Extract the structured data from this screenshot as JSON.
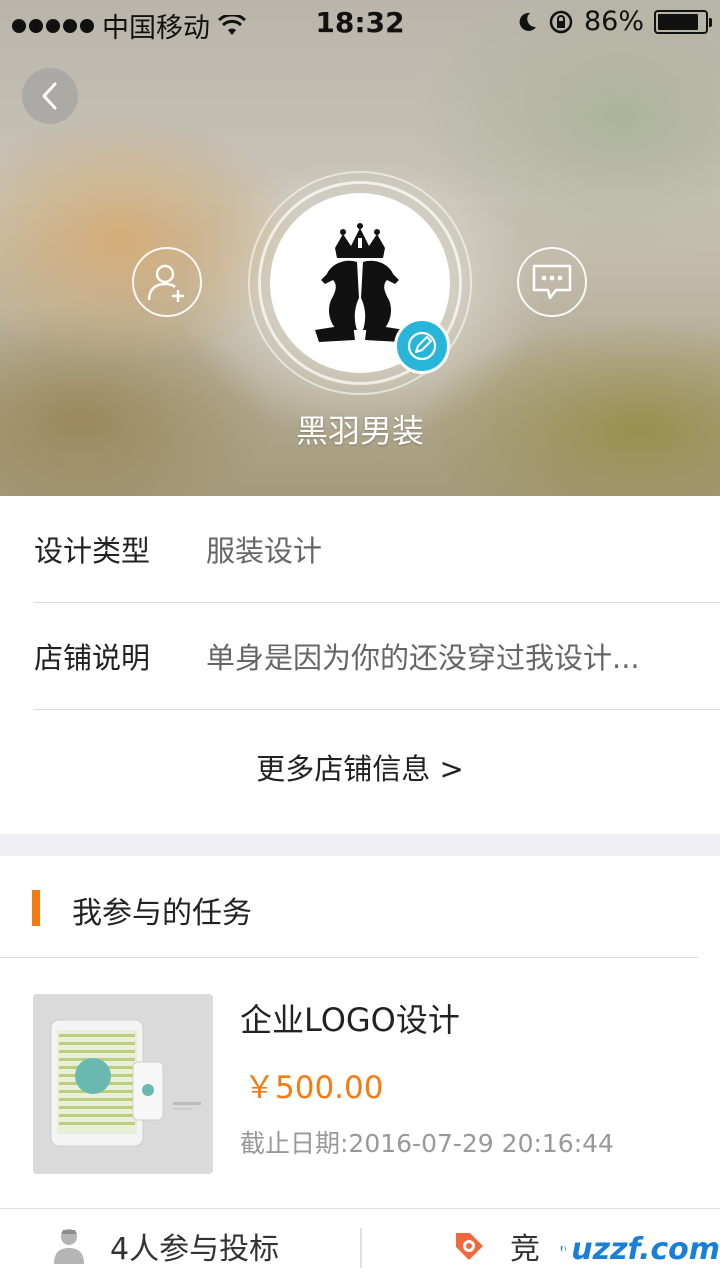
{
  "status_bar": {
    "carrier": "中国移动",
    "time": "18:32",
    "battery": "86%",
    "battery_level": 0.86
  },
  "header": {
    "shop_name": "黑羽男装",
    "back_icon": "chevron-left-icon",
    "follow_icon": "add-user-icon",
    "message_icon": "chat-bubble-icon",
    "edit_icon": "pencil-icon"
  },
  "info": {
    "design_type_label": "设计类型",
    "design_type_value": "服装设计",
    "shop_desc_label": "店铺说明",
    "shop_desc_value": "单身是因为你的还没穿过我设计...",
    "more_link": "更多店铺信息 >"
  },
  "tasks": {
    "section_title": "我参与的任务",
    "items": [
      {
        "title": "企业LOGO设计",
        "price": "￥500.00",
        "deadline": "截止日期:2016-07-29 20:16:44"
      }
    ]
  },
  "bottom_bar": {
    "bidders": "4人参与投标",
    "second_label": "竞",
    "watermark": "uzzf.com",
    "watermark_small": "东坡下载"
  },
  "colors": {
    "accent": "#f47c10",
    "edit_badge": "#27b6d9"
  }
}
